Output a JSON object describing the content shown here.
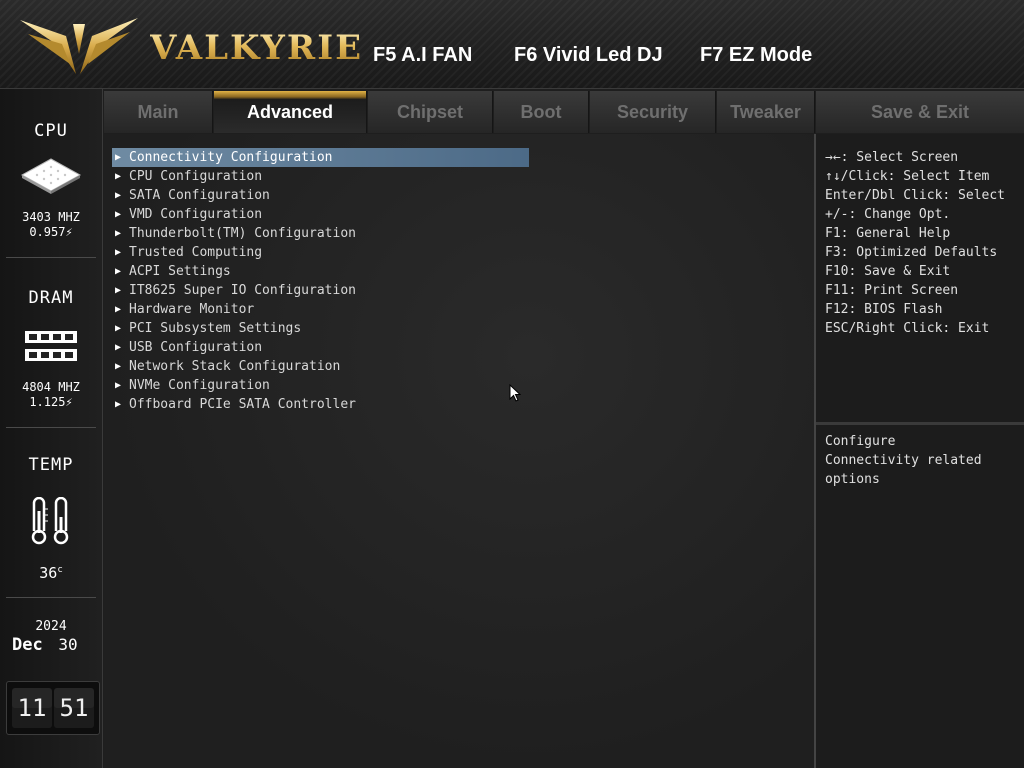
{
  "header": {
    "brand": "VALKYRIE",
    "hotkeys": [
      "F5 A.I FAN",
      "F6 Vivid Led DJ",
      "F7 EZ Mode"
    ]
  },
  "sidebar": {
    "cpu": {
      "title": "CPU",
      "freq": "3403 MHZ",
      "volt": "0.957"
    },
    "dram": {
      "title": "DRAM",
      "freq": "4804 MHZ",
      "volt": "1.125"
    },
    "temp": {
      "title": "TEMP",
      "value": "36",
      "unit": "c"
    },
    "date": {
      "year": "2024",
      "month": "Dec",
      "day": "30"
    },
    "time": {
      "hours": "11",
      "minutes": "51"
    }
  },
  "tabs": [
    {
      "label": "Main"
    },
    {
      "label": "Advanced"
    },
    {
      "label": "Chipset"
    },
    {
      "label": "Boot"
    },
    {
      "label": "Security"
    },
    {
      "label": "Tweaker"
    },
    {
      "label": "Save & Exit"
    }
  ],
  "active_tab": "Advanced",
  "menu": [
    {
      "label": "Connectivity Configuration"
    },
    {
      "label": "CPU Configuration"
    },
    {
      "label": "SATA Configuration"
    },
    {
      "label": "VMD Configuration"
    },
    {
      "label": "Thunderbolt(TM) Configuration"
    },
    {
      "label": "Trusted Computing"
    },
    {
      "label": "ACPI Settings"
    },
    {
      "label": "IT8625 Super IO Configuration"
    },
    {
      "label": "Hardware Monitor"
    },
    {
      "label": "PCI Subsystem Settings"
    },
    {
      "label": "USB Configuration"
    },
    {
      "label": "Network Stack Configuration"
    },
    {
      "label": "NVMe Configuration"
    },
    {
      "label": "Offboard PCIe SATA Controller"
    }
  ],
  "selected_item": "Connectivity Configuration",
  "help": [
    "→←: Select Screen",
    "↑↓/Click: Select Item",
    "Enter/Dbl Click: Select",
    "+/-: Change Opt.",
    "F1: General Help",
    "F3: Optimized Defaults",
    "F10: Save & Exit",
    "F11: Print Screen",
    "F12: BIOS Flash",
    "ESC/Right Click: Exit"
  ],
  "description": [
    "Configure",
    "Connectivity related",
    "options"
  ],
  "icons": {
    "logo": "winged-logo-icon",
    "cpu": "cpu-chip-icon",
    "dram": "memory-module-icon",
    "temp": "thermometer-icon",
    "volt": "lightning-icon",
    "cursor": "mouse-pointer-icon"
  },
  "colors": {
    "accent_gold": "#e1b346",
    "selection": "#5a7896",
    "panel": "#1e1e1e"
  }
}
